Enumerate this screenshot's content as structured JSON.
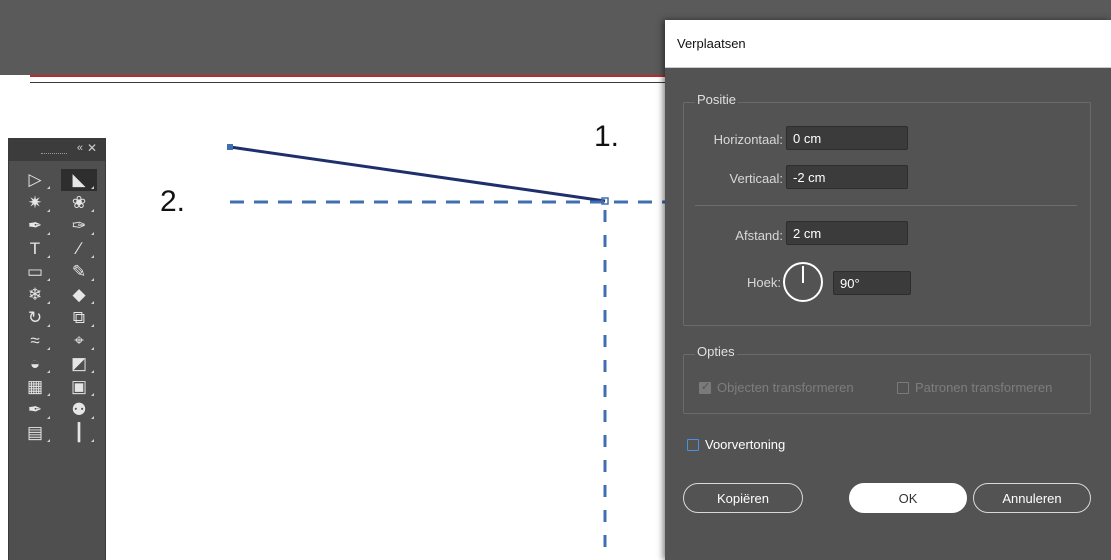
{
  "annotations": {
    "one": "1.",
    "two": "2."
  },
  "tools": [
    {
      "icon": "selection-tool-icon",
      "glyph": "▷"
    },
    {
      "icon": "direct-selection-tool-icon",
      "glyph": "◣",
      "active": true
    },
    {
      "icon": "magic-wand-tool-icon",
      "glyph": "✷"
    },
    {
      "icon": "lasso-tool-icon",
      "glyph": "❀"
    },
    {
      "icon": "pen-tool-icon",
      "glyph": "✒"
    },
    {
      "icon": "curvature-tool-icon",
      "glyph": "✑"
    },
    {
      "icon": "type-tool-icon",
      "glyph": "T"
    },
    {
      "icon": "line-segment-tool-icon",
      "glyph": "∕"
    },
    {
      "icon": "rectangle-tool-icon",
      "glyph": "▭"
    },
    {
      "icon": "paintbrush-tool-icon",
      "glyph": "✎"
    },
    {
      "icon": "shaper-tool-icon",
      "glyph": "❄"
    },
    {
      "icon": "eraser-tool-icon",
      "glyph": "◆"
    },
    {
      "icon": "rotate-tool-icon",
      "glyph": "↻"
    },
    {
      "icon": "scale-tool-icon",
      "glyph": "⧉"
    },
    {
      "icon": "width-tool-icon",
      "glyph": "≈"
    },
    {
      "icon": "free-transform-tool-icon",
      "glyph": "⌖"
    },
    {
      "icon": "shape-builder-tool-icon",
      "glyph": "◒"
    },
    {
      "icon": "perspective-grid-tool-icon",
      "glyph": "◩"
    },
    {
      "icon": "mesh-tool-icon",
      "glyph": "▦"
    },
    {
      "icon": "gradient-tool-icon",
      "glyph": "▣"
    },
    {
      "icon": "eyedropper-tool-icon",
      "glyph": "✒"
    },
    {
      "icon": "blend-tool-icon",
      "glyph": "⚉"
    },
    {
      "icon": "symbol-sprayer-tool-icon",
      "glyph": "▤"
    },
    {
      "icon": "column-graph-tool-icon",
      "glyph": "┃"
    }
  ],
  "dialog": {
    "title": "Verplaatsen",
    "position_group": "Positie",
    "horizontal_label": "Horizontaal:",
    "horizontal_value": "0 cm",
    "vertical_label": "Verticaal:",
    "vertical_value": "-2 cm",
    "distance_label": "Afstand:",
    "distance_value": "2 cm",
    "angle_label": "Hoek:",
    "angle_value": "90°",
    "options_group": "Opties",
    "transform_objects": "Objecten transformeren",
    "transform_patterns": "Patronen transformeren",
    "preview": "Voorvertoning",
    "copy_button": "Kopiëren",
    "ok_button": "OK",
    "cancel_button": "Annuleren"
  },
  "colors": {
    "accent_blue": "#4a90e2",
    "path_dark": "#1f2f6b",
    "guide_blue": "#3f6fb0",
    "bar_red": "#c0282b"
  }
}
